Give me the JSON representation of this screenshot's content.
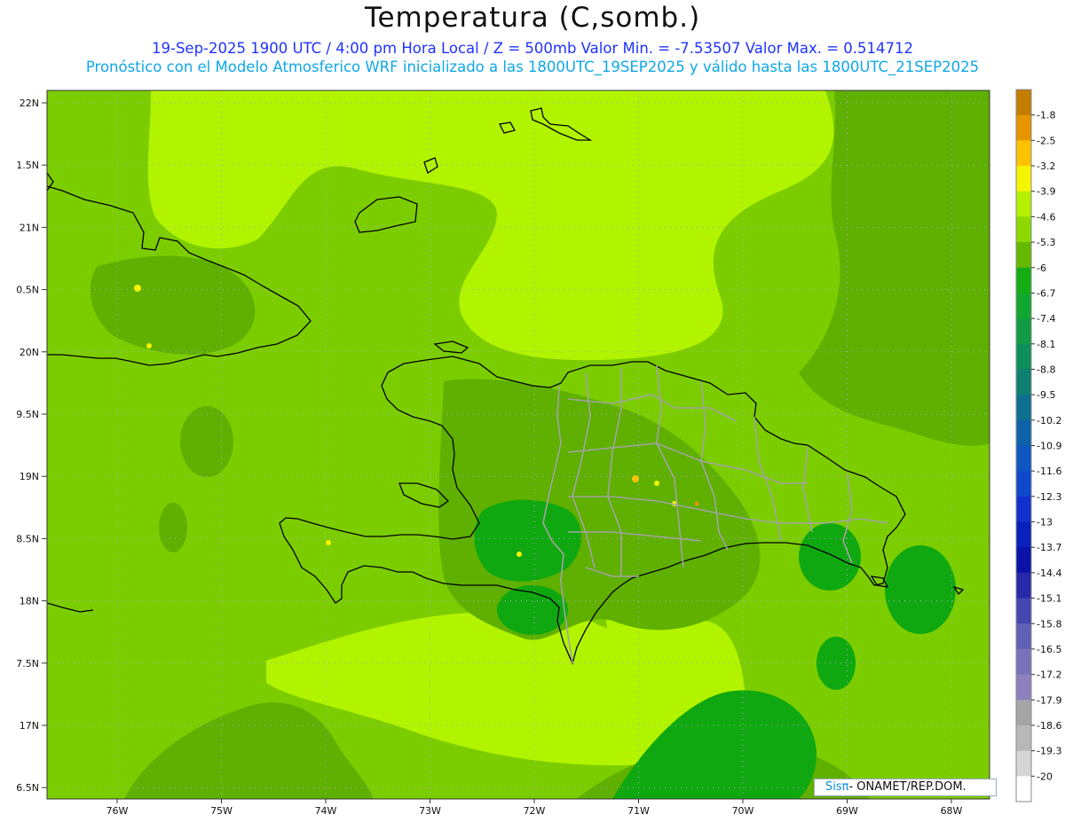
{
  "header": {
    "title": "Temperatura (C,somb.)",
    "subtitle_line1": "19-Sep-2025  1900 UTC / 4:00 pm Hora Local / Z = 500mb  Valor Min. = -7.53507  Valor Max. = 0.514712",
    "subtitle_line2": "Pronóstico con el Modelo Atmosferico WRF inicializado a las 1800UTC_19SEP2025 y válido hasta las  1800UTC_21SEP2025"
  },
  "map": {
    "lon_labels": [
      "76W",
      "75W",
      "74W",
      "73W",
      "72W",
      "71W",
      "70W",
      "69W",
      "68W"
    ],
    "lat_labels": [
      "22N",
      "1.5N",
      "21N",
      "0.5N",
      "20N",
      "9.5N",
      "19N",
      "8.5N",
      "18N",
      "7.5N",
      "17N",
      "6.5N"
    ],
    "colors": {
      "field_base": "#7ccd00",
      "field_light": "#b2f400",
      "field_dark": "#5fb000",
      "field_green": "#10a810",
      "coast": "#000000",
      "border": "#a3a3a3"
    }
  },
  "colorbar": {
    "labels": [
      "-1.8",
      "-2.5",
      "-3.2",
      "-3.9",
      "-4.6",
      "-5.3",
      "-6",
      "-6.7",
      "-7.4",
      "-8.1",
      "-8.8",
      "-9.5",
      "-10.2",
      "-10.9",
      "-11.6",
      "-12.3",
      "-13",
      "-13.7",
      "-14.4",
      "-15.1",
      "-15.8",
      "-16.5",
      "-17.2",
      "-17.9",
      "-18.6",
      "-19.3",
      "-20"
    ],
    "colors": [
      "#c27c00",
      "#e79600",
      "#ffc200",
      "#f5f500",
      "#b4f000",
      "#8cd800",
      "#66b800",
      "#13ad13",
      "#10a830",
      "#109b45",
      "#0f8f5a",
      "#0e8070",
      "#0e7090",
      "#0d62aa",
      "#0f56c2",
      "#1048cc",
      "#1230cc",
      "#0a20bb",
      "#0a12aa",
      "#2828aa",
      "#4646b0",
      "#6060b4",
      "#7a72b8",
      "#8e80be",
      "#a5a5a5",
      "#b8b8b8",
      "#d5d5d5",
      "#ffffff"
    ]
  },
  "credit": {
    "brand": "Sisπ",
    "org": "- ONAMET/REP.DOM."
  }
}
